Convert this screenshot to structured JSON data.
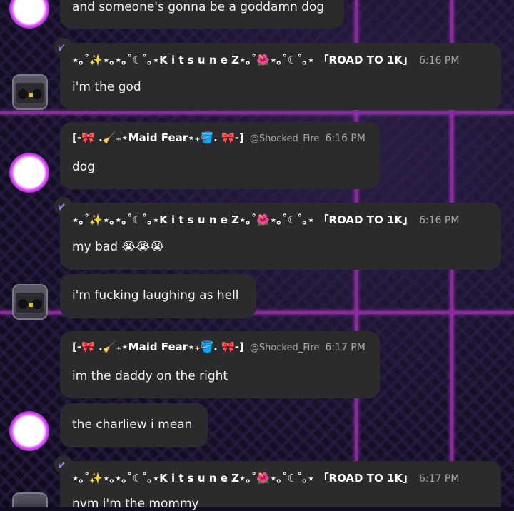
{
  "theme": {
    "accent_purple": "#8a2a9c",
    "bubble_bg": "#2b2b2e",
    "name_color": "#ffffff",
    "meta_color": "#a7a7a7"
  },
  "icons": {
    "crown": "crown-icon",
    "avatar_maid": "maid-avatar",
    "avatar_radio": "boombox-avatar"
  },
  "messages": [
    {
      "author": "",
      "handle": "",
      "time": "",
      "text": "and someone's gonna be a goddamn dog"
    },
    {
      "author": "⋆｡˚✨⋆｡⋆｡˚☾˚｡⋆K i t s u n e Z⋆｡˚🌺⋆｡˚☾˚｡⋆ 「ROAD TO 1K」",
      "handle": "",
      "time": "6:16 PM",
      "text": "i'm the god"
    },
    {
      "author": "[-🎀 .🧹₊⋆Maid Fear⋆₊🪣. 🎀-]",
      "handle": "@Shocked_Fire",
      "time": "6:16 PM",
      "text": "dog"
    },
    {
      "author": "⋆｡˚✨⋆｡⋆｡˚☾˚｡⋆K i t s u n e Z⋆｡˚🌺⋆｡˚☾˚｡⋆ 「ROAD TO 1K」",
      "handle": "",
      "time": "6:16 PM",
      "text": "my bad 😭😭😭"
    },
    {
      "author": "",
      "handle": "",
      "time": "",
      "text": "i'm fucking laughing as hell"
    },
    {
      "author": "[-🎀 .🧹₊⋆Maid Fear⋆₊🪣. 🎀-]",
      "handle": "@Shocked_Fire",
      "time": "6:17 PM",
      "text": "im the daddy on the right"
    },
    {
      "author": "",
      "handle": "",
      "time": "",
      "text": "the charliew i mean"
    },
    {
      "author": "⋆｡˚✨⋆｡⋆｡˚☾˚｡⋆K i t s u n e Z⋆｡˚🌺⋆｡˚☾˚｡⋆ 「ROAD TO 1K」",
      "handle": "",
      "time": "6:17 PM",
      "text": "nvm i'm the mommy"
    }
  ]
}
